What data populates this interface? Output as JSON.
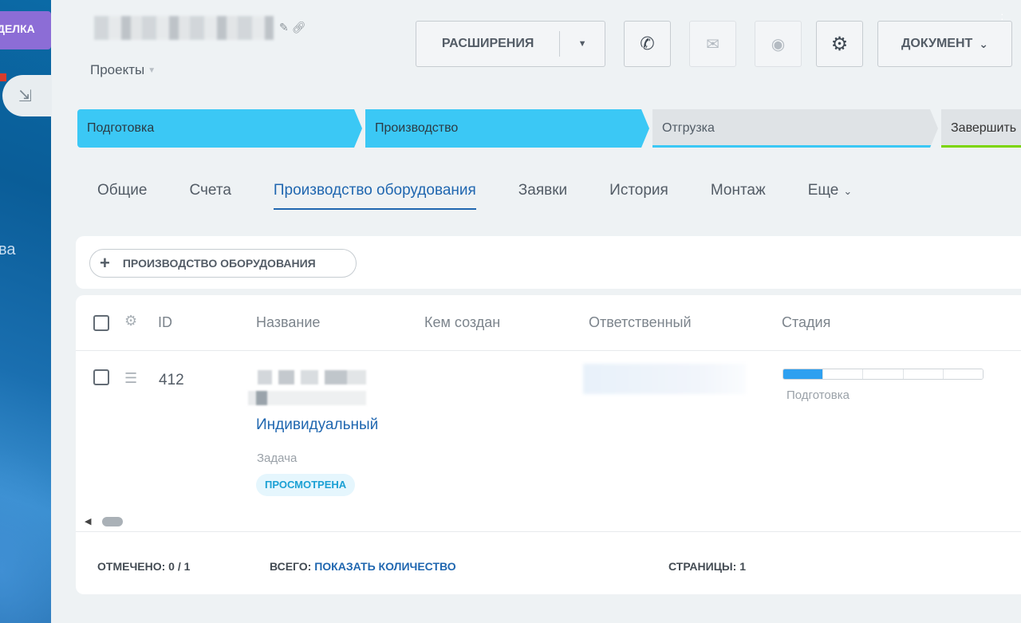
{
  "sidebar": {
    "deal_label": "ДЕЛКА",
    "partial_text": "ва"
  },
  "header": {
    "section": "Проекты",
    "extensions_label": "РАСШИРЕНИЯ",
    "document_label": "ДОКУМЕНТ"
  },
  "stages": [
    {
      "label": "Подготовка"
    },
    {
      "label": "Производство"
    },
    {
      "label": "Отгрузка"
    },
    {
      "label": "Завершить"
    }
  ],
  "tabs": [
    {
      "label": "Общие"
    },
    {
      "label": "Счета"
    },
    {
      "label": "Производство оборудования"
    },
    {
      "label": "Заявки"
    },
    {
      "label": "История"
    },
    {
      "label": "Монтаж"
    },
    {
      "label": "Еще"
    }
  ],
  "add_button": {
    "label": "ПРОИЗВОДСТВО ОБОРУДОВАНИЯ"
  },
  "table": {
    "columns": [
      "ID",
      "Название",
      "Кем создан",
      "Ответственный",
      "Стадия"
    ],
    "rows": [
      {
        "id": "412",
        "name_line": "Индивидуальный",
        "type": "Задача",
        "badge": "ПРОСМОТРЕНА",
        "stage": "Подготовка",
        "stage_progress": 0.2
      }
    ]
  },
  "footer": {
    "marked_label": "ОТМЕЧЕНО:",
    "marked_value": "0 / 1",
    "total_label": "ВСЕГО:",
    "total_link": "ПОКАЗАТЬ КОЛИЧЕСТВО",
    "pages_label": "СТРАНИЦЫ:",
    "pages_value": "1"
  },
  "colors": {
    "stage_active": "#3bc8f5",
    "link": "#2067b0",
    "badge_text": "#1ba0d4",
    "progress_fill": "#2ea0f0"
  }
}
